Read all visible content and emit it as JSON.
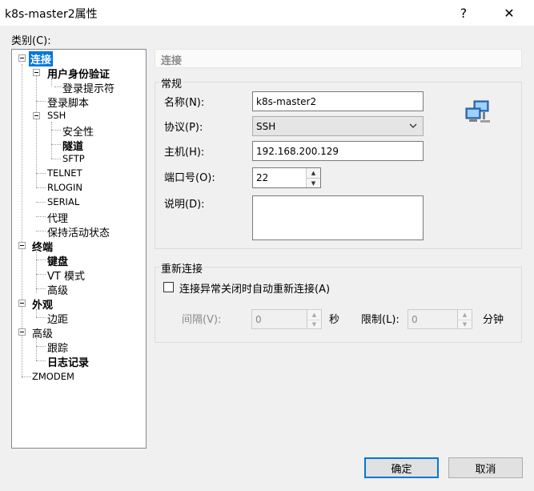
{
  "window": {
    "title": "k8s-master2属性"
  },
  "titlebar": {
    "help_label": "?",
    "close_label": "✕"
  },
  "category_label": "类别(C):",
  "tree": {
    "connection": "连接",
    "auth": "用户身份验证",
    "login_prompt": "登录提示符",
    "login_script": "登录脚本",
    "ssh": "SSH",
    "security": "安全性",
    "tunnel": "隧道",
    "sftp": "SFTP",
    "telnet": "TELNET",
    "rlogin": "RLOGIN",
    "serial": "SERIAL",
    "proxy": "代理",
    "keepalive": "保持活动状态",
    "terminal": "终端",
    "keyboard": "键盘",
    "vt_mode": "VT 模式",
    "advanced_term": "高级",
    "appearance": "外观",
    "margin": "边距",
    "advanced": "高级",
    "trace": "跟踪",
    "logging": "日志记录",
    "zmodem": "ZMODEM"
  },
  "panel": {
    "header": "连接",
    "general_group": "常规",
    "name_label": "名称(N):",
    "name_value": "k8s-master2",
    "protocol_label": "协议(P):",
    "protocol_value": "SSH",
    "host_label": "主机(H):",
    "host_value": "192.168.200.129",
    "port_label": "端口号(O):",
    "port_value": "22",
    "desc_label": "说明(D):",
    "desc_value": "",
    "reconnect_group": "重新连接",
    "reconnect_checkbox": "连接异常关闭时自动重新连接(A)",
    "interval_label": "间隔(V):",
    "interval_value": "0",
    "seconds_unit": "秒",
    "limit_label": "限制(L):",
    "limit_value": "0",
    "minutes_unit": "分钟"
  },
  "buttons": {
    "ok": "确定",
    "cancel": "取消"
  },
  "colors": {
    "selection": "#0078d7",
    "default_button_border": "#0078d7"
  },
  "icons": {
    "network_icon": "network-computers-icon"
  }
}
